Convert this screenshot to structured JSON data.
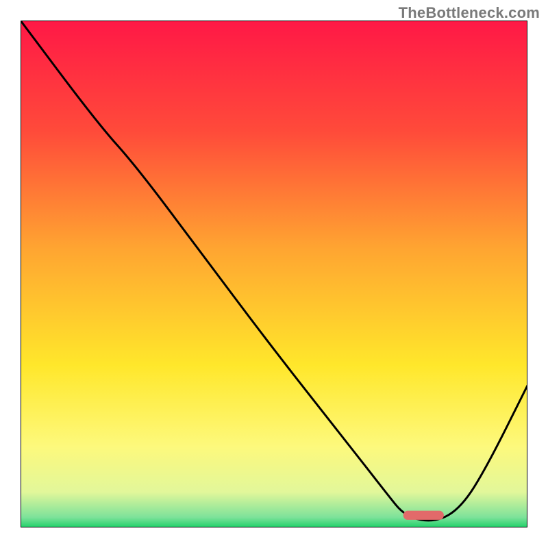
{
  "watermark": "TheBottleneck.com",
  "chart_data": {
    "type": "line",
    "title": "",
    "xlabel": "",
    "ylabel": "",
    "xlim": [
      0,
      1
    ],
    "ylim": [
      0,
      1
    ],
    "background_gradient": {
      "stops": [
        {
          "pos": 0.0,
          "color": "#ff1846"
        },
        {
          "pos": 0.22,
          "color": "#ff4b3a"
        },
        {
          "pos": 0.45,
          "color": "#ffa531"
        },
        {
          "pos": 0.68,
          "color": "#ffe72b"
        },
        {
          "pos": 0.84,
          "color": "#fdf97c"
        },
        {
          "pos": 0.93,
          "color": "#e2f79a"
        },
        {
          "pos": 0.98,
          "color": "#7de29a"
        },
        {
          "pos": 1.0,
          "color": "#1fd169"
        }
      ]
    },
    "series": [
      {
        "name": "bottleneck-curve",
        "color": "#000000",
        "stroke_width": 3,
        "x": [
          0.0,
          0.15,
          0.23,
          0.35,
          0.5,
          0.65,
          0.72,
          0.76,
          0.82,
          0.87,
          0.92,
          1.0
        ],
        "y": [
          1.0,
          0.8,
          0.71,
          0.55,
          0.35,
          0.16,
          0.07,
          0.02,
          0.01,
          0.04,
          0.12,
          0.28
        ]
      }
    ],
    "marker": {
      "name": "optimal-range",
      "shape": "rounded-bar",
      "color": "#e26a6a",
      "x_range": [
        0.755,
        0.835
      ],
      "y": 0.015,
      "height": 0.018
    },
    "axes": {
      "frame_color": "#000000",
      "frame_width": 2,
      "ticks": false,
      "grid": false
    }
  }
}
